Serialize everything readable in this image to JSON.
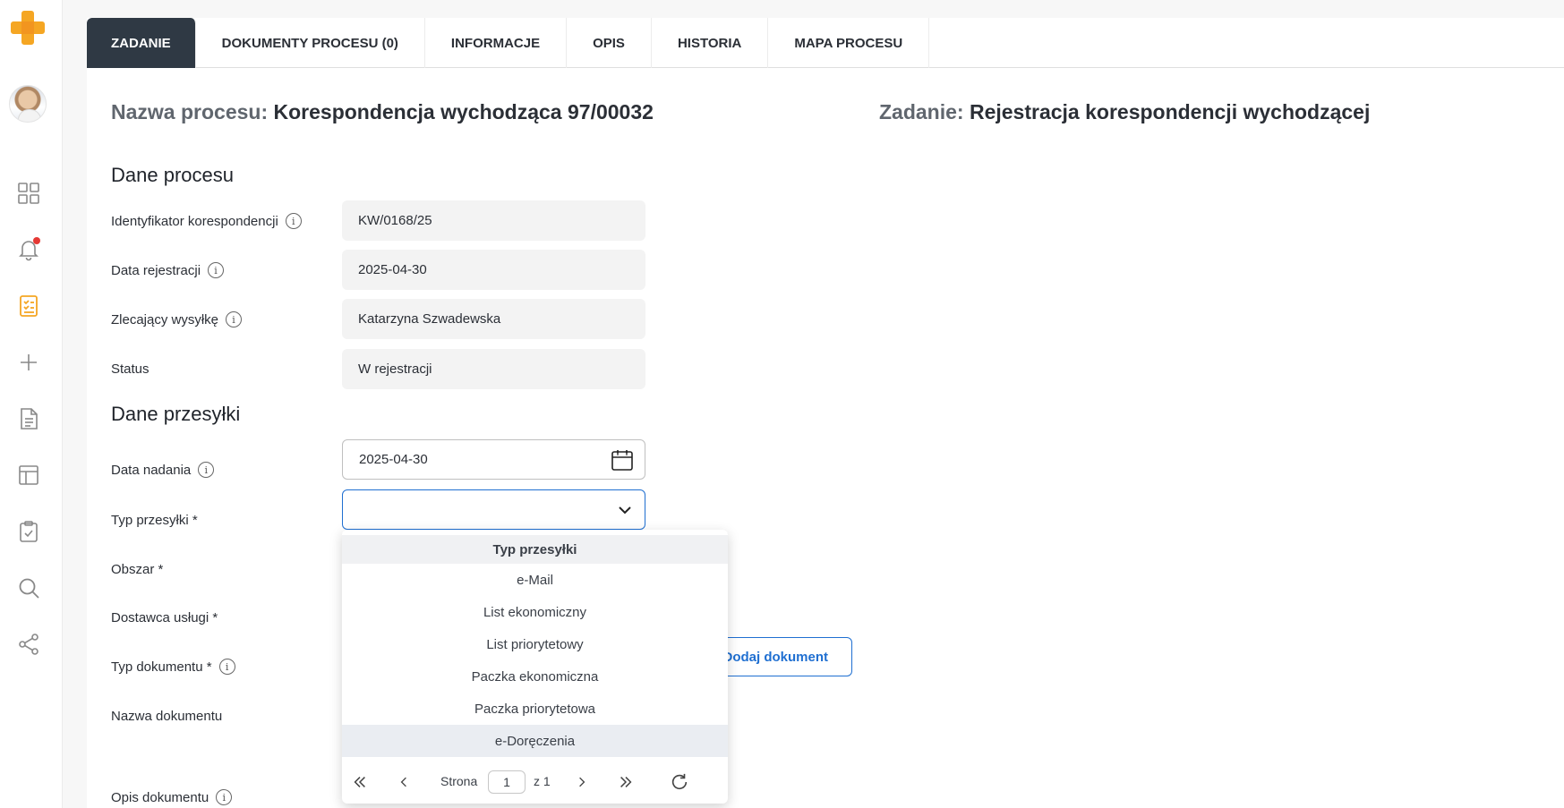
{
  "tabs": [
    {
      "label": "ZADANIE",
      "active": true
    },
    {
      "label": "DOKUMENTY PROCESU (0)"
    },
    {
      "label": "INFORMACJE"
    },
    {
      "label": "OPIS"
    },
    {
      "label": "HISTORIA"
    },
    {
      "label": "MAPA PROCESU"
    }
  ],
  "header": {
    "process_label": "Nazwa procesu:",
    "process_value": "Korespondencja wychodząca 97/00032",
    "task_label": "Zadanie:",
    "task_value": "Rejestracja korespondencji wychodzącej"
  },
  "process_section": {
    "title": "Dane procesu",
    "fields": [
      {
        "label": "Identyfikator korespondencji",
        "value": "KW/0168/25"
      },
      {
        "label": "Data rejestracji",
        "value": "2025-04-30"
      },
      {
        "label": "Zlecający wysyłkę",
        "value": "Katarzyna Szwadewska"
      },
      {
        "label": "Status",
        "value": "W rejestracji"
      }
    ]
  },
  "shipment_section": {
    "title": "Dane przesyłki",
    "date_label": "Data nadania",
    "date_value": "2025-04-30",
    "type_label": "Typ przesyłki *",
    "type_value": "",
    "area_label": "Obszar *",
    "provider_label": "Dostawca usługi *",
    "doc_type_label": "Typ dokumentu *",
    "doc_name_label": "Nazwa dokumentu",
    "doc_desc_label": "Opis dokumentu",
    "add_document_button": "Dodaj dokument"
  },
  "dropdown": {
    "header": "Typ przesyłki",
    "options": [
      "e-Mail",
      "List ekonomiczny",
      "List priorytetowy",
      "Paczka ekonomiczna",
      "Paczka priorytetowa",
      "e-Doręczenia"
    ],
    "hovered_index": 5,
    "pager": {
      "page_label": "Strona",
      "page": "1",
      "of_label": "z 1"
    }
  },
  "colors": {
    "accent": "#1f6fd1",
    "active_tab": "#2f3944",
    "logo": "#f5a623",
    "nav_active": "#f5a623",
    "notification": "#e53935"
  }
}
